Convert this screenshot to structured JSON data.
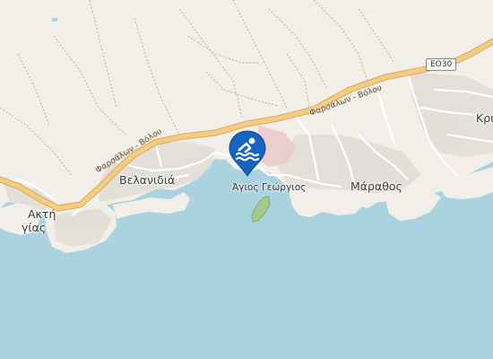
{
  "map": {
    "labels": {
      "velanidia": "Βελανιδιά",
      "agios_georgios": "Άγιος Γεώργιος",
      "marathos": "Μάραθος",
      "akti_line1": "Ακτή",
      "akti_line2": "γίας",
      "kri": "Κρι"
    },
    "roads": {
      "farsala_volos_1": "Φαρσάλων - Βόλου",
      "farsala_volos_2": "Φαρσάλων - Βόλου",
      "eo30": "ΕΟ30"
    },
    "marker": {
      "icon": "swimming-beach-icon",
      "color": "#1565c0"
    },
    "colors": {
      "sea": "#aad3df",
      "land": "#f2efe9",
      "urban": "#e0dcd6",
      "road": "#f4cd83",
      "park": "#a4c98a",
      "restricted": "#eac9c9"
    }
  }
}
